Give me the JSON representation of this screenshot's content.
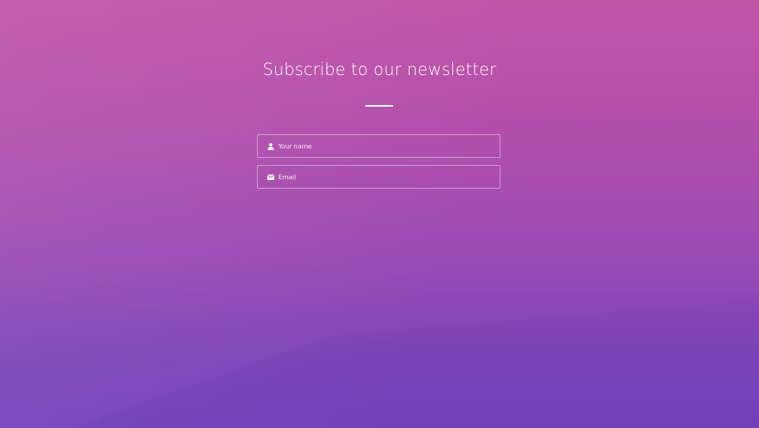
{
  "newsletter": {
    "title": "Subscribe to our newsletter",
    "fields": {
      "name": {
        "placeholder": "Your name",
        "value": "",
        "icon": "user-icon"
      },
      "email": {
        "placeholder": "Email",
        "value": "",
        "icon": "envelope-icon"
      }
    }
  },
  "colors": {
    "background_top": "#c254a8",
    "background_bottom": "#7342b8",
    "text": "#ffffff"
  }
}
